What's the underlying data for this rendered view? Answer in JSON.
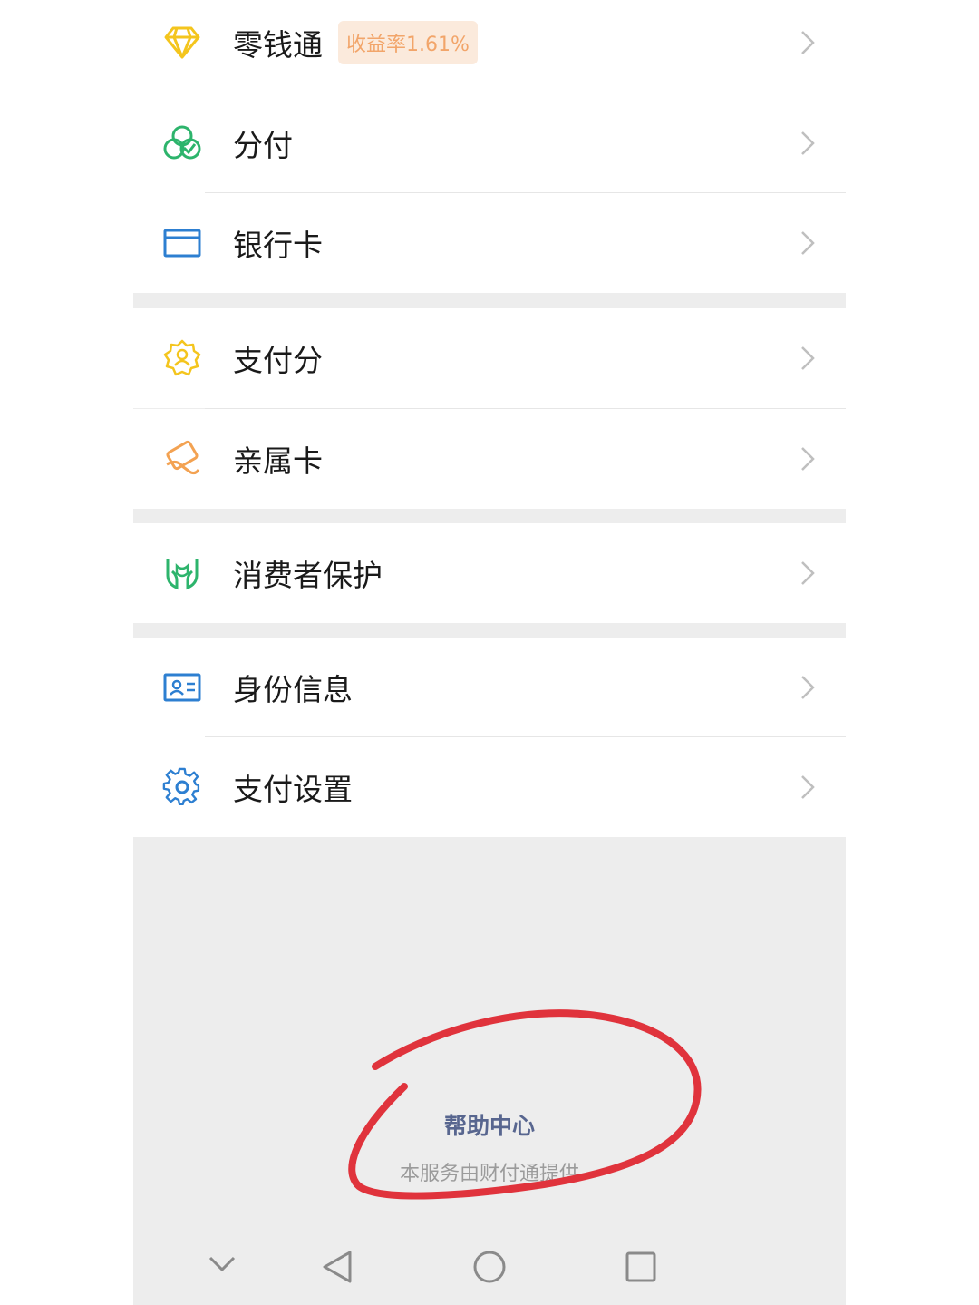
{
  "menu": {
    "group1": [
      {
        "label": "零钱通",
        "badge": "收益率1.61%",
        "icon": "diamond-icon"
      },
      {
        "label": "分付",
        "icon": "fenfu-icon"
      },
      {
        "label": "银行卡",
        "icon": "bank-card-icon"
      }
    ],
    "group2": [
      {
        "label": "支付分",
        "icon": "pay-score-icon"
      },
      {
        "label": "亲属卡",
        "icon": "family-card-icon"
      }
    ],
    "group3": [
      {
        "label": "消费者保护",
        "icon": "consumer-protection-icon"
      }
    ],
    "group4": [
      {
        "label": "身份信息",
        "icon": "id-card-icon"
      },
      {
        "label": "支付设置",
        "icon": "gear-icon"
      }
    ]
  },
  "footer": {
    "help_center": "帮助中心",
    "provider_text": "本服务由财付通提供"
  },
  "colors": {
    "yellow": "#f4c51d",
    "green": "#2db46c",
    "blue": "#2d7fd1",
    "orange": "#f3a252",
    "annotation_red": "#e0333c",
    "help_link": "#58668f"
  },
  "nav_bar": [
    "back-chevron-icon",
    "back-triangle-icon",
    "home-circle-icon",
    "recents-square-icon"
  ]
}
